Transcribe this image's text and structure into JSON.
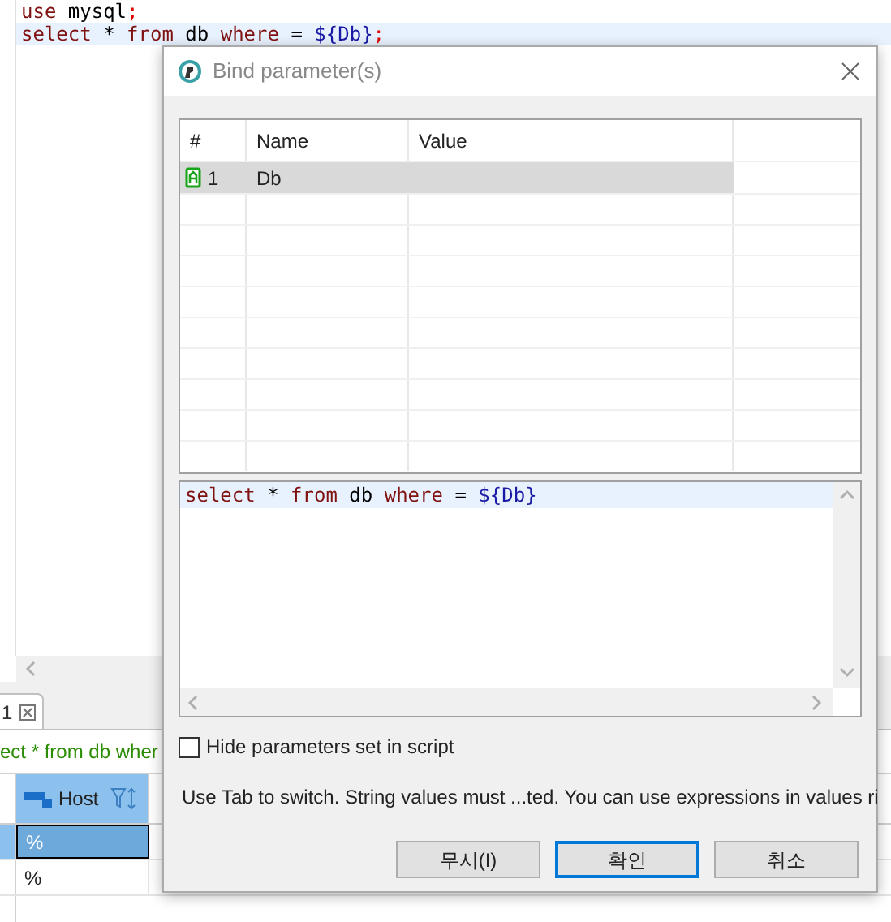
{
  "editor": {
    "lines": [
      {
        "selected": false,
        "tokens": [
          {
            "kind": "keyword",
            "text": "use"
          },
          {
            "kind": "plain",
            "text": " mysql"
          },
          {
            "kind": "punct",
            "text": ";"
          }
        ]
      },
      {
        "selected": true,
        "tokens": [
          {
            "kind": "keyword",
            "text": "select"
          },
          {
            "kind": "plain",
            "text": " * "
          },
          {
            "kind": "keyword",
            "text": "from"
          },
          {
            "kind": "plain",
            "text": " db "
          },
          {
            "kind": "keyword",
            "text": "where"
          },
          {
            "kind": "plain",
            "text": " = "
          },
          {
            "kind": "param",
            "text": "${Db}"
          },
          {
            "kind": "punct",
            "text": ";"
          }
        ]
      }
    ]
  },
  "results_tab": {
    "label": "1",
    "selected": true
  },
  "query_line": "ect * from db wher",
  "grid": {
    "columns": [
      {
        "label": "Host",
        "selected": true
      }
    ],
    "rows": [
      {
        "cells": [
          "%"
        ],
        "selected": true
      },
      {
        "cells": [
          "%"
        ],
        "selected": false
      }
    ]
  },
  "dialog": {
    "title": "Bind parameter(s)",
    "table": {
      "columns": [
        "#",
        "Name",
        "Value"
      ],
      "rows": [
        {
          "index": "1",
          "name": "Db",
          "selected": true
        }
      ]
    },
    "sql_preview": {
      "tokens": [
        {
          "kind": "keyword",
          "text": "select"
        },
        {
          "kind": "plain",
          "text": " * "
        },
        {
          "kind": "keyword",
          "text": "from"
        },
        {
          "kind": "plain",
          "text": " db "
        },
        {
          "kind": "keyword",
          "text": "where"
        },
        {
          "kind": "plain",
          "text": " = "
        },
        {
          "kind": "param",
          "text": "${Db}"
        }
      ]
    },
    "hide_checkbox": {
      "label": "Hide parameters set in script",
      "checked": false
    },
    "hint": "Use Tab to switch. String values must ...ted. You can use expressions in values  ri",
    "buttons": [
      {
        "label": "무시(I)",
        "default": false
      },
      {
        "label": "확인",
        "default": true
      },
      {
        "label": "취소",
        "default": false
      }
    ]
  }
}
